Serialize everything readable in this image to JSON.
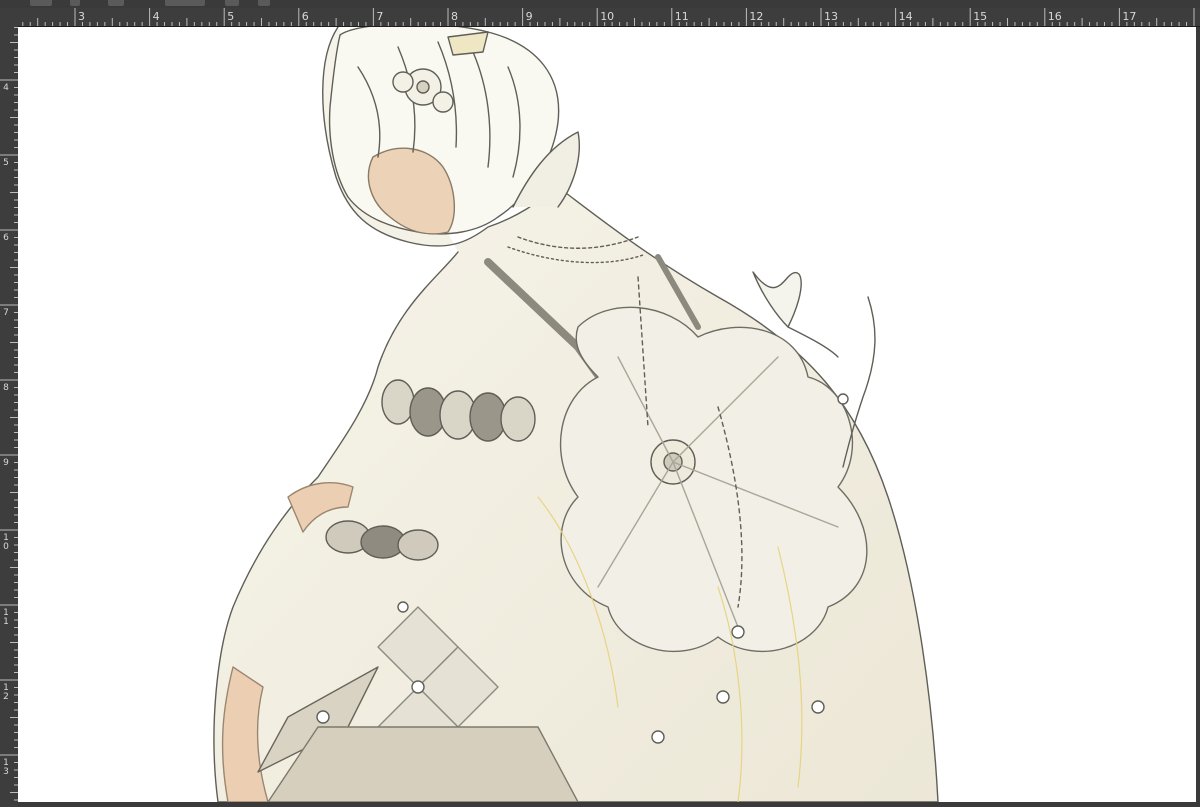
{
  "app": {
    "ruler": {
      "unit_labels": [
        "3",
        "4",
        "5",
        "6",
        "7",
        "8",
        "9",
        "10",
        "11",
        "12",
        "13",
        "14",
        "15",
        "16",
        "17"
      ],
      "vertical_labels": [
        "4",
        "5",
        "6",
        "7",
        "8",
        "9",
        "10",
        "11",
        "12",
        "13"
      ]
    },
    "canvas": {
      "description_icon": "illustration-artwork",
      "background_color": "#ffffff"
    }
  },
  "colors": {
    "ui_dark": "#2b2b2b",
    "ruler_bg": "#3d3d3d",
    "line_art": "#6b6a62",
    "paper": "#f4f1e6",
    "skin": "#e9c9aa",
    "accent_gold": "#e6d27a",
    "shade_grey": "#a9a597"
  }
}
